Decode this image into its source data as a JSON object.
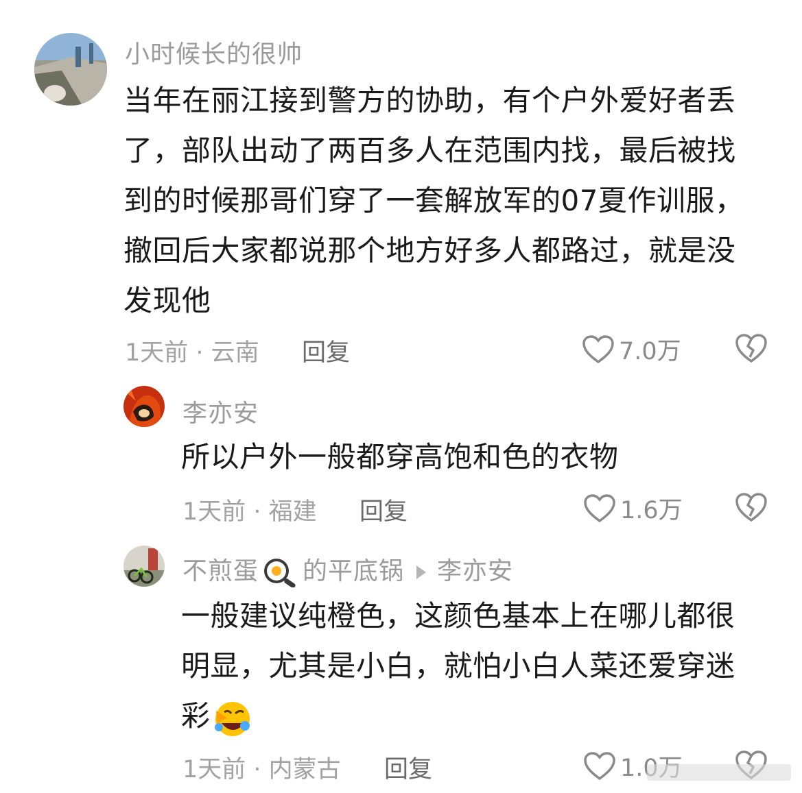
{
  "comments": [
    {
      "username": "小时候长的很帅",
      "lines": [
        "当年在丽江接到警方的协助，有个户外爱好者丢",
        "了，部队出动了两百多人在范围内找，最后被找",
        "到的时候那哥们穿了一套解放军的07夏作训服，",
        "撤回后大家都说那个地方好多人都路过，就是没",
        "发现他"
      ],
      "meta": "1天前 · 云南",
      "reply": "回复",
      "likes": "7.0万"
    },
    {
      "username": "李亦安",
      "lines": [
        "所以户外一般都穿高饱和色的衣物"
      ],
      "meta": "1天前 · 福建",
      "reply": "回复",
      "likes": "1.6万"
    },
    {
      "username_part1": "不煎蛋",
      "username_part2": "的平底锅",
      "reply_to": "李亦安",
      "lines": [
        "一般建议纯橙色，这颜色基本上在哪儿都很",
        "明显，尤其是小白，就怕小白人菜还爱穿迷",
        "彩"
      ],
      "meta": "1天前 · 内蒙古",
      "reply": "回复",
      "likes": "1.0万"
    }
  ],
  "icons": {
    "like": "heart-icon",
    "dislike": "broken-heart-icon",
    "pan_emoji": "frying-pan-emoji",
    "laugh_emoji": "laughing-emoji"
  }
}
